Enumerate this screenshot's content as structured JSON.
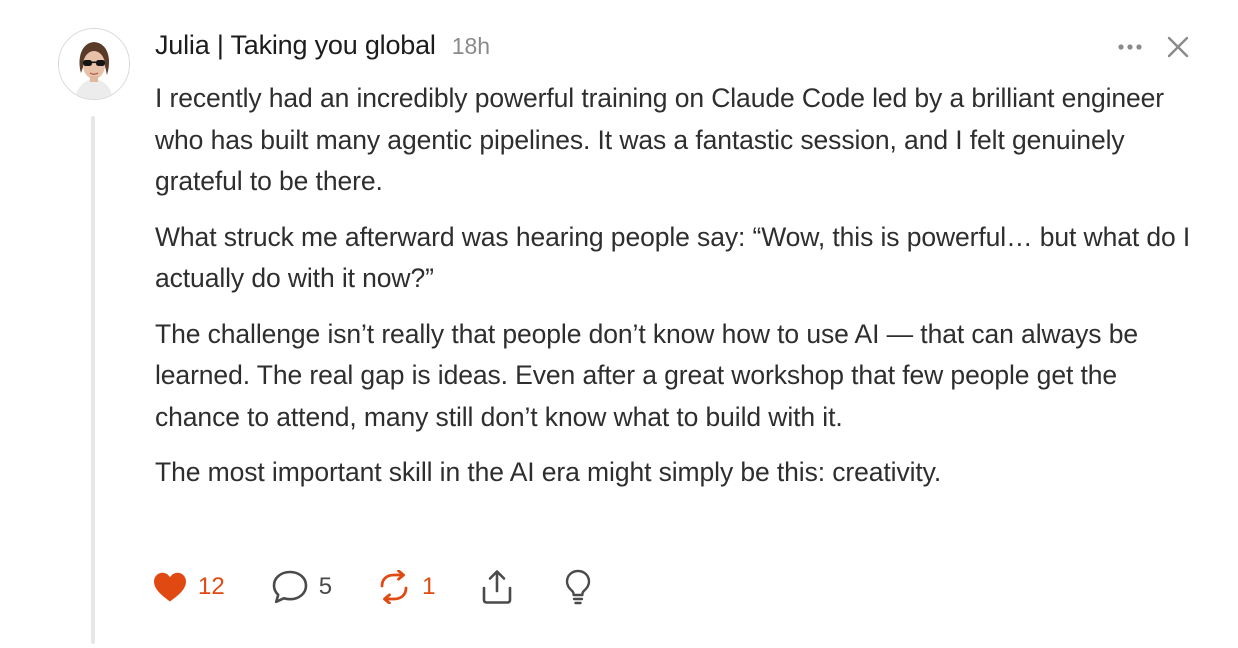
{
  "post": {
    "author": "Julia | Taking you global",
    "timestamp": "18h",
    "paragraphs": [
      "I recently had an incredibly powerful training on Claude Code led by a brilliant engineer who has built many agentic pipelines. It was a fantastic session, and I felt genuinely grateful to be there.",
      "What struck me afterward was hearing people say: “Wow, this is powerful… but what do I actually do with it now?”",
      "The challenge isn’t really that people don’t know how to use AI — that can always be learned. The real gap is ideas. Even after a great workshop that few people get the chance to attend, many still don’t know what to build with it.",
      "The most important skill in the AI era might simply be this: creativity."
    ]
  },
  "actions": {
    "like_count": "12",
    "reply_count": "5",
    "repost_count": "1"
  },
  "icons": {
    "menu": "more-horizontal-icon",
    "close": "close-icon",
    "like": "heart-icon",
    "reply": "comment-bubble-icon",
    "repost": "repost-icon",
    "share": "share-icon",
    "insight": "lightbulb-icon"
  },
  "colors": {
    "accent": "#e04a12",
    "text": "#2e2e2e",
    "muted": "#8a8a8a",
    "thread_line": "#e6e6e6"
  }
}
